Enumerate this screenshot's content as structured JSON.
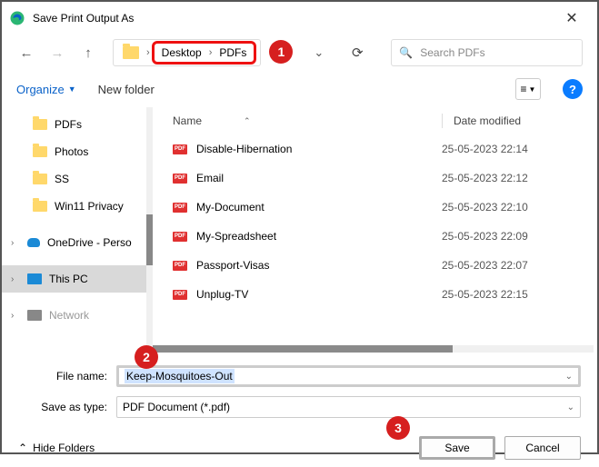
{
  "window": {
    "title": "Save Print Output As",
    "close": "✕"
  },
  "breadcrumb": {
    "part1": "Desktop",
    "part2": "PDFs",
    "sep": "›"
  },
  "search": {
    "placeholder": "Search PDFs"
  },
  "toolbar": {
    "organize": "Organize",
    "newfolder": "New folder",
    "help": "?"
  },
  "sidebar": {
    "items": [
      {
        "label": "PDFs",
        "icon": "folder"
      },
      {
        "label": "Photos",
        "icon": "folder"
      },
      {
        "label": "SS",
        "icon": "folder"
      },
      {
        "label": "Win11 Privacy",
        "icon": "folder"
      },
      {
        "label": "OneDrive - Perso",
        "icon": "onedrive",
        "expandable": true
      },
      {
        "label": "This PC",
        "icon": "pc",
        "expandable": true,
        "selected": true
      },
      {
        "label": "Network",
        "icon": "network",
        "expandable": true,
        "faded": true
      }
    ]
  },
  "columns": {
    "name": "Name",
    "date": "Date modified"
  },
  "files": [
    {
      "name": "Disable-Hibernation",
      "date": "25-05-2023 22:14"
    },
    {
      "name": "Email",
      "date": "25-05-2023 22:12"
    },
    {
      "name": "My-Document",
      "date": "25-05-2023 22:10"
    },
    {
      "name": "My-Spreadsheet",
      "date": "25-05-2023 22:09"
    },
    {
      "name": "Passport-Visas",
      "date": "25-05-2023 22:07"
    },
    {
      "name": "Unplug-TV",
      "date": "25-05-2023 22:15"
    }
  ],
  "form": {
    "filename_label": "File name:",
    "filename_value": "Keep-Mosquitoes-Out",
    "savetype_label": "Save as type:",
    "savetype_value": "PDF Document (*.pdf)"
  },
  "buttons": {
    "hide": "Hide Folders",
    "save": "Save",
    "cancel": "Cancel"
  },
  "annotations": {
    "b1": "1",
    "b2": "2",
    "b3": "3"
  }
}
